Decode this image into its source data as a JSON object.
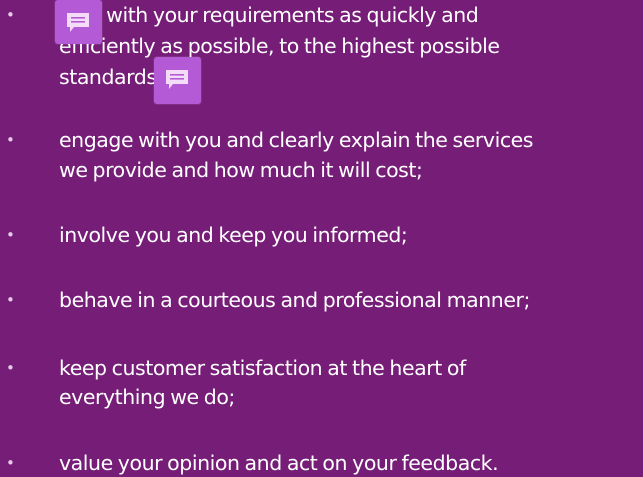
{
  "bullets": [
    {
      "symbol": "•",
      "lines": [
        "deal with your requirements as quickly and",
        "efficiently as possible, to the highest possible",
        "standards;"
      ]
    },
    {
      "symbol": "•",
      "lines": [
        "engage with you and clearly explain the services",
        "we provide and how much it will cost;"
      ]
    },
    {
      "symbol": "•",
      "lines": [
        "involve you and keep you informed;"
      ]
    },
    {
      "symbol": "•",
      "lines": [
        "behave in a courteous and professional manner;"
      ]
    },
    {
      "symbol": "•",
      "lines": [
        "keep customer satisfaction at the heart of",
        "everything we do;"
      ]
    },
    {
      "symbol": "•",
      "lines": [
        "value your opinion and act on your feedback."
      ]
    }
  ],
  "overlay_icons": [
    "comment-icon",
    "comment-icon"
  ],
  "colors": {
    "background": "#761d78",
    "text": "#ffffff",
    "bullet": "#e3cbe5",
    "icon_background": "#b55ad6",
    "icon_glyph": "#f4dcf8"
  }
}
